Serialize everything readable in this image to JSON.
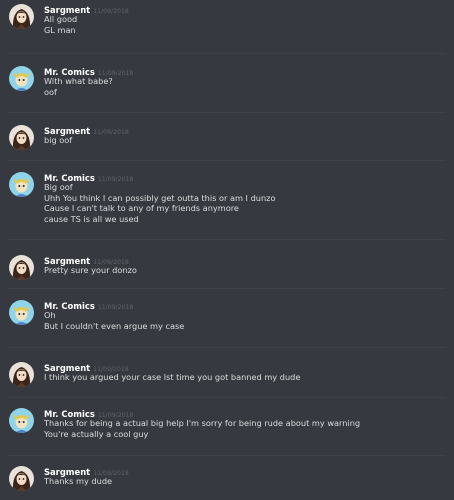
{
  "users": {
    "sargment": {
      "name": "Sargment",
      "avatar_icon": "anime-girl-avatar-icon",
      "avatar_bg": "#e9e2d8"
    },
    "comics": {
      "name": "Mr. Comics",
      "avatar_icon": "cartoon-character-avatar-icon",
      "avatar_bg": "#8fd4e8"
    }
  },
  "messages": [
    {
      "author": "Sargment",
      "timestamp": "11/09/2018",
      "lines": [
        "All good",
        "GL man"
      ]
    },
    {
      "author": "Mr. Comics",
      "timestamp": "11/09/2018",
      "lines": [
        "With what babe?",
        "oof"
      ]
    },
    {
      "author": "Sargment",
      "timestamp": "11/09/2018",
      "lines": [
        "big oof"
      ]
    },
    {
      "author": "Mr. Comics",
      "timestamp": "11/09/2018",
      "lines": [
        "Big oof",
        "Uhh You think I can possibly get outta this or am I dunzo",
        "Cause I can't talk to any of my friends anymore",
        "cause TS is all we used"
      ]
    },
    {
      "author": "Sargment",
      "timestamp": "11/09/2018",
      "lines": [
        "Pretty sure your donzo"
      ]
    },
    {
      "author": "Mr. Comics",
      "timestamp": "11/09/2018",
      "lines": [
        "Oh",
        "But I couldn't even argue my case"
      ]
    },
    {
      "author": "Sargment",
      "timestamp": "11/09/2018",
      "lines": [
        "I think you argued your case lst time you got banned my dude"
      ]
    },
    {
      "author": "Mr. Comics",
      "timestamp": "11/09/2018",
      "lines": [
        "Thanks for being a actual big help I'm sorry for being rude about my warning",
        "You're actually a cool guy"
      ]
    },
    {
      "author": "Sargment",
      "timestamp": "11/09/2018",
      "lines": [
        "Thanks my dude"
      ]
    }
  ]
}
